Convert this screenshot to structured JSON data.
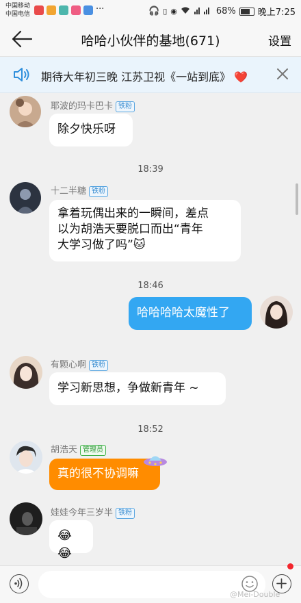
{
  "status_bar": {
    "carrier_1": "中国移动",
    "carrier_2": "中国电信",
    "more": "···",
    "battery": "68%",
    "time": "晚上7:25"
  },
  "header": {
    "title": "哈哈小伙伴的基地(671)",
    "settings_label": "设置"
  },
  "announcement": {
    "text": "期待大年初三晚  江苏卫视《一站到底》",
    "emoji": "❤️"
  },
  "messages": [
    {
      "sender": "耶波的玛卡巴卡",
      "badge": "铁粉",
      "text": "除夕快乐呀"
    },
    {
      "time": "18:39"
    },
    {
      "sender": "十二半糖",
      "badge": "铁粉",
      "text_line1": "拿着玩偶出来的一瞬间，差点",
      "text_line2": "以为胡浩天要脱口而出“青年",
      "text_line3": "大学习做了吗”",
      "emoji": "🐱"
    },
    {
      "time": "18:46"
    },
    {
      "text": "哈哈哈哈太魔性了",
      "self": true
    },
    {
      "sender": "有颗心啊",
      "badge": "铁粉",
      "text": "学习新思想，争做新青年 ~"
    },
    {
      "time": "18:52"
    },
    {
      "sender": "胡浩天",
      "badge": "管理员",
      "text": "真的很不协调嘛"
    },
    {
      "sender": "娃娃今年三岁半",
      "badge": "铁粉",
      "text": "😂😂"
    }
  ],
  "input_bar": {
    "placeholder": ""
  },
  "watermark": "@Mei-Double",
  "colors": {
    "self_bubble": "#33a7f2",
    "admin_bubble": "#ff8c00",
    "badge_blue": "#3d8fd1",
    "badge_green": "#2f9a38",
    "notice_bg": "#eaf4fc"
  }
}
